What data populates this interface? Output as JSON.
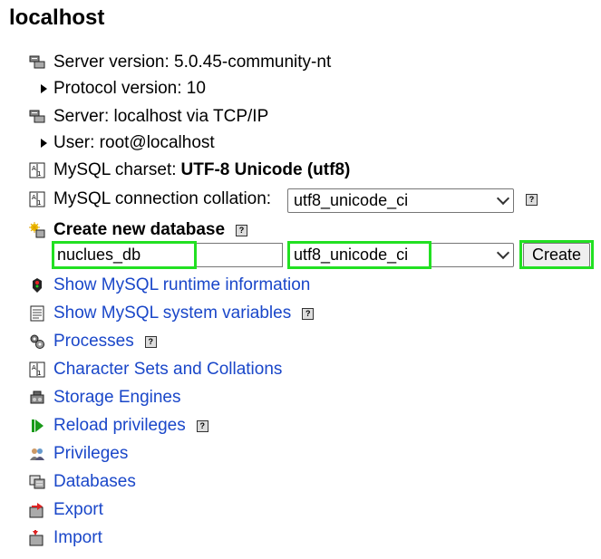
{
  "title": "localhost",
  "server_info": [
    {
      "icon": "server-icon",
      "text": "Server version: 5.0.45-community-nt"
    },
    {
      "icon": "bullet",
      "text": "Protocol version: 10"
    },
    {
      "icon": "server-icon",
      "text": "Server: localhost via TCP/IP"
    },
    {
      "icon": "bullet",
      "text": "User: root@localhost"
    }
  ],
  "charset": {
    "label": "MySQL charset: ",
    "value": "UTF-8 Unicode (utf8)"
  },
  "collation": {
    "label": "MySQL connection collation:",
    "value": "utf8_unicode_ci"
  },
  "create_db": {
    "label": "Create new database",
    "name_value": "nuclues_db",
    "collation_value": "utf8_unicode_ci",
    "button": "Create"
  },
  "help_glyph": "?",
  "links": [
    {
      "icon": "runtime-icon",
      "label": "Show MySQL runtime information"
    },
    {
      "icon": "variables-icon",
      "label": "Show MySQL system variables",
      "help": true
    },
    {
      "icon": "processes-icon",
      "label": "Processes",
      "help": true
    },
    {
      "icon": "charset-icon",
      "label": "Character Sets and Collations"
    },
    {
      "icon": "engines-icon",
      "label": "Storage Engines"
    },
    {
      "icon": "reload-icon",
      "label": "Reload privileges",
      "help": true
    },
    {
      "icon": "privileges-icon",
      "label": "Privileges"
    },
    {
      "icon": "databases-icon",
      "label": "Databases"
    },
    {
      "icon": "export-icon",
      "label": "Export"
    },
    {
      "icon": "import-icon",
      "label": "Import"
    }
  ],
  "colors": {
    "link": "#1a47c9",
    "highlight": "#22e022"
  }
}
